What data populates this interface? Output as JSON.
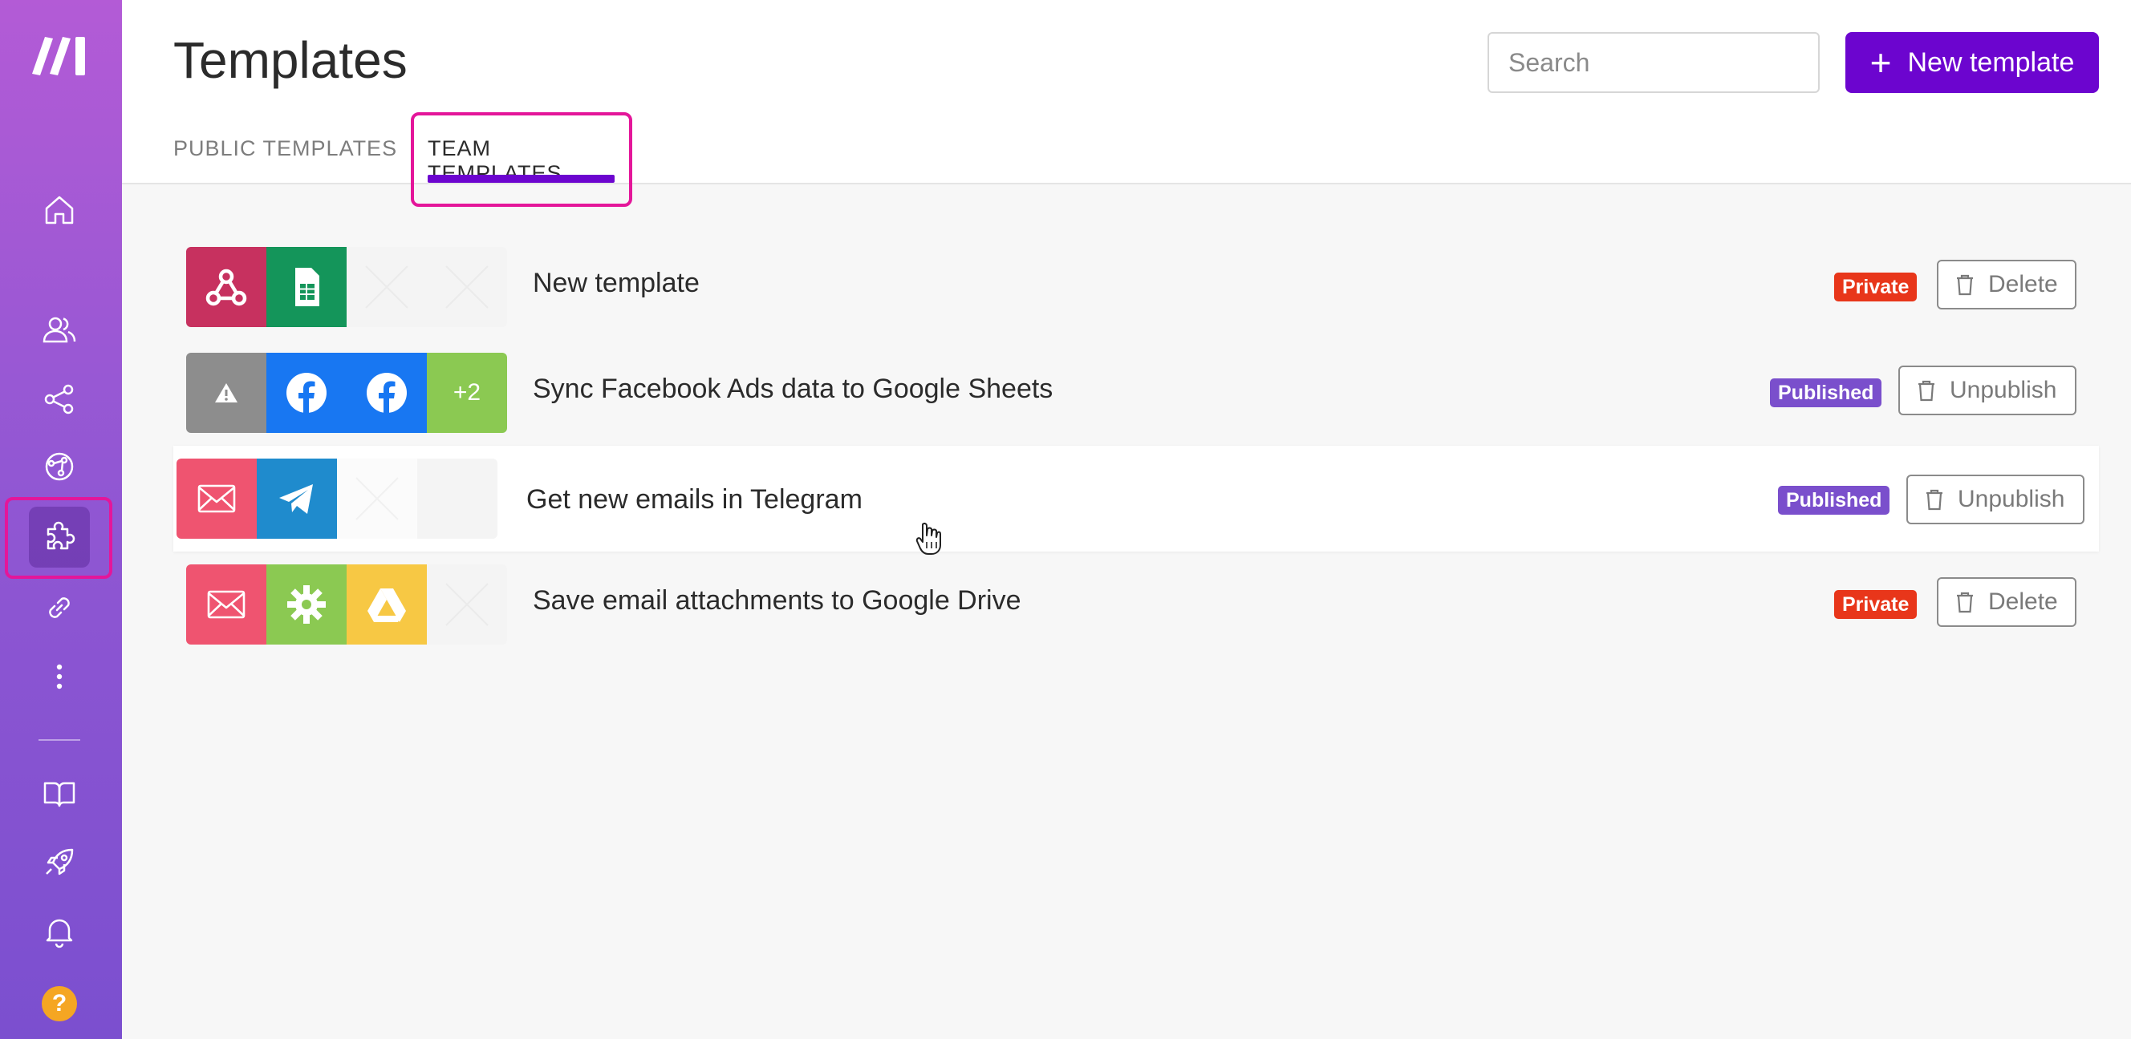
{
  "header": {
    "title": "Templates",
    "search_placeholder": "Search",
    "new_button_label": "New template",
    "tabs": [
      {
        "label": "PUBLIC TEMPLATES",
        "active": false
      },
      {
        "label": "TEAM TEMPLATES",
        "active": true
      }
    ]
  },
  "sidebar": {
    "items": [
      {
        "icon": "home-icon"
      },
      {
        "icon": "team-icon"
      },
      {
        "icon": "share-icon"
      },
      {
        "icon": "scenarios-icon"
      },
      {
        "icon": "puzzle-icon",
        "active": true
      },
      {
        "icon": "link-icon"
      },
      {
        "icon": "more-icon"
      },
      {
        "icon": "book-icon"
      },
      {
        "icon": "rocket-icon"
      },
      {
        "icon": "bell-icon"
      }
    ],
    "help_label": "?"
  },
  "templates": [
    {
      "title": "New template",
      "status": "Private",
      "action": "Delete",
      "apps": [
        "webhooks-icon",
        "google-sheets-icon",
        "placeholder",
        "placeholder"
      ]
    },
    {
      "title": "Sync Facebook Ads data to Google Sheets",
      "status": "Published",
      "action": "Unpublish",
      "apps": [
        "warning-icon",
        "facebook-icon",
        "facebook-icon",
        "+2"
      ]
    },
    {
      "title": "Get new emails in Telegram",
      "status": "Published",
      "action": "Unpublish",
      "apps": [
        "email-icon",
        "telegram-icon",
        "placeholder",
        "placeholder"
      ]
    },
    {
      "title": "Save email attachments to Google Drive",
      "status": "Private",
      "action": "Delete",
      "apps": [
        "email-icon",
        "tools-icon",
        "google-drive-icon",
        "placeholder"
      ]
    }
  ],
  "colors": {
    "brand": "#6c05cf",
    "private": "#e8361a",
    "published": "#7a4fcc",
    "highlight": "#e4169a"
  },
  "more_apps_label": "+2"
}
